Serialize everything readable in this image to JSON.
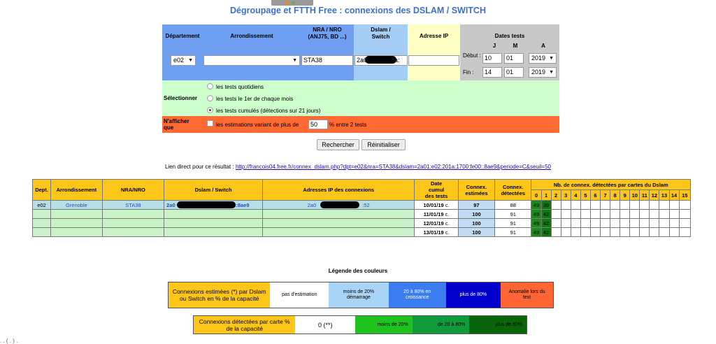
{
  "page": {
    "title": "Dégroupage et FTTH Free : connexions des DSLAM / SWITCH"
  },
  "form": {
    "headers": {
      "departement": "Département",
      "arrondissement": "Arrondissement",
      "nra": "NRA / NRO",
      "nra_sub": "(ANJ75, BD ...)",
      "dslam": "Dslam /",
      "dslam_sub": "Switch",
      "ip": "Adresse IP",
      "dates": "Dates tests",
      "j": "J",
      "m": "M",
      "a": "A"
    },
    "departement_value": "e02",
    "arrondissement_value": "",
    "nra_value": "STA38",
    "dslam_value_start": "2a0",
    "dslam_value_end": "1a:",
    "ip_value": "",
    "debut_label": "Début :",
    "fin_label": "Fin :",
    "debut": {
      "j": "10",
      "m": "01",
      "a": "2019"
    },
    "fin": {
      "j": "14",
      "m": "01",
      "a": "2019"
    },
    "selectionner_label": "Sélectionner",
    "options": [
      {
        "label": "les tests quotidiens",
        "checked": false
      },
      {
        "label": "les tests le 1er de chaque mois",
        "checked": false
      },
      {
        "label": "les tests cumulés (détections sur 21 jours)",
        "checked": true
      }
    ],
    "nafficher_label": "N'afficher que",
    "estim_before": "les estimations variant de plus de",
    "estim_value": "50",
    "estim_after": "% entre 2 tests",
    "search_button": "Rechercher",
    "reset_button": "Réinitialiser"
  },
  "link": {
    "prefix": "Lien direct pour ce résultat :",
    "url": "http://francois04.free.fr/connex_dslam.php?dpt=e02&nra=STA38&dslam=2a01:e02:201a:1700:fe00::8ae9&periode=C&seuil=50"
  },
  "results": {
    "headers": {
      "dept": "Dept.",
      "arr": "Arrondissement",
      "nra": "NRA/NRO",
      "dslam": "Dslam / Switch",
      "ips": "Adresses IP des connexions",
      "date": "Date cumul des tests",
      "date_l1": "Date",
      "date_l2": "cumul",
      "date_l3": "des tests",
      "est_l1": "Connex.",
      "est_l2": "estimées",
      "det_l1": "Connex.",
      "det_l2": "détectées",
      "cards": "Nb. de connex. détectées par cartes du Dslam"
    },
    "card_numbers": [
      "0",
      "1",
      "2",
      "3",
      "4",
      "5",
      "6",
      "7",
      "8",
      "9",
      "10",
      "11",
      "12",
      "13",
      "14",
      "15"
    ],
    "rows": [
      {
        "dept": "e02",
        "arr": "Grenoble",
        "nra": "STA38",
        "dslam_start": "2a0",
        "dslam_end": "0::8ae9",
        "ip_start": "2a0",
        "ip_end": ":52",
        "date": "10/01/19",
        "date_suffix": "c.",
        "est": "97",
        "det": "88",
        "c0": "49",
        "c1": "39"
      },
      {
        "dept": "",
        "arr": "",
        "nra": "",
        "dslam_start": "",
        "dslam_end": "",
        "ip_start": "",
        "ip_end": "",
        "date": "11/01/19",
        "date_suffix": "c.",
        "est": "100",
        "det": "91",
        "c0": "49",
        "c1": "42"
      },
      {
        "dept": "",
        "arr": "",
        "nra": "",
        "dslam_start": "",
        "dslam_end": "",
        "ip_start": "",
        "ip_end": "",
        "date": "12/01/19",
        "date_suffix": "c.",
        "est": "100",
        "det": "91",
        "c0": "49",
        "c1": "42"
      },
      {
        "dept": "",
        "arr": "",
        "nra": "",
        "dslam_start": "",
        "dslam_end": "",
        "ip_start": "",
        "ip_end": "",
        "date": "13/01/19",
        "date_suffix": "c.",
        "est": "100",
        "det": "91",
        "c0": "49",
        "c1": "42"
      }
    ]
  },
  "legend": {
    "title": "Légende des couleurs",
    "row1": {
      "head": "Connexions estimées (*) par Dslam ou Switch en % de la capacité",
      "cells": [
        {
          "text": "pas d'estimation",
          "color": "#ffffff",
          "fg": "#000000"
        },
        {
          "text": "moins de 20% démarrage",
          "color": "#a8d4f8",
          "fg": "#000000"
        },
        {
          "text": "20 à 80% en croissance",
          "color": "#3b7df0",
          "fg": "#ffffff"
        },
        {
          "text": "plus de 80%",
          "color": "#0000cc",
          "fg": "#ffffff"
        },
        {
          "text": "Anomalie lors du test",
          "color": "#ff6633",
          "fg": "#000000"
        }
      ]
    },
    "row2": {
      "head": "Connexions détectées par carte % de la capacité",
      "cells": [
        {
          "text": "0 (**)",
          "color": "#ffffff",
          "fg": "#000000"
        },
        {
          "text": "moins de 20%",
          "color": "#1ec31e",
          "fg": "#000000"
        },
        {
          "text": "de 20 à 80%",
          "color": "#0f9a3c",
          "fg": "#000000"
        },
        {
          "text": "plus de 80%",
          "color": "#0a640a",
          "fg": "#000000"
        }
      ]
    }
  },
  "colors": {
    "title_blue": "#3d72c8",
    "header_blue": "#6f9ff0",
    "header_lightblue": "#a6cdf6",
    "ip_yellow": "#ffffc4",
    "dates_grey": "#c8c8c8",
    "select_green": "#ccffcc",
    "nafficher_orange": "#ff6a33",
    "table_header": "#ffc61a"
  },
  "footer": {
    "dots": ". . ( . ) ."
  }
}
